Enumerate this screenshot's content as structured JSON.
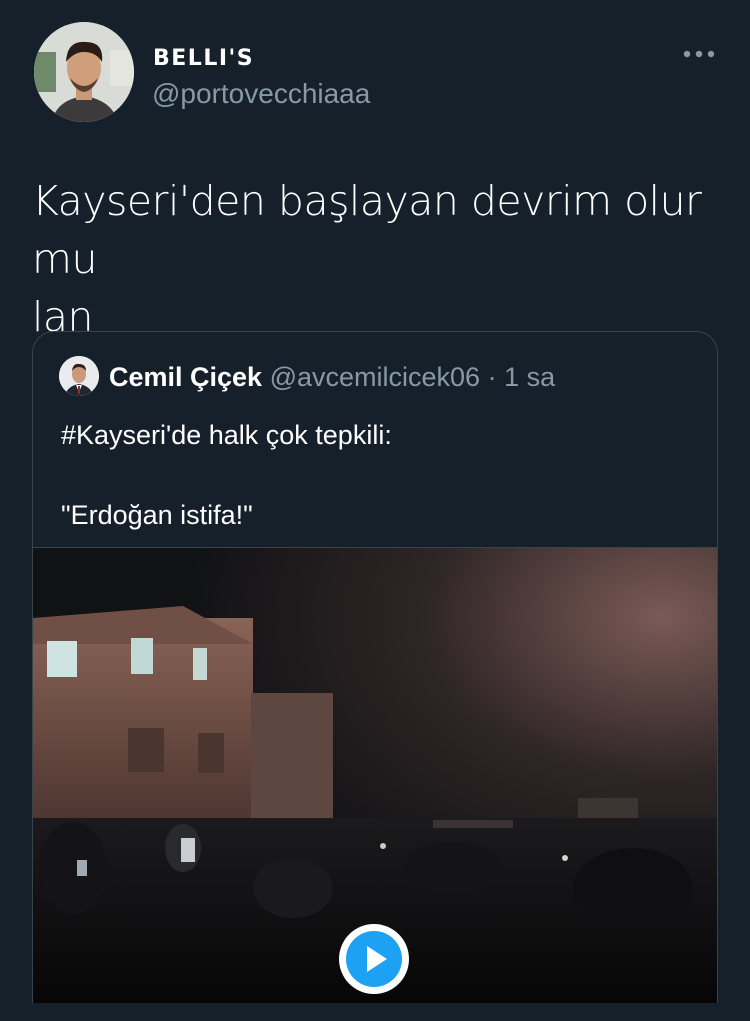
{
  "tweet": {
    "display_name": "BELLI'S",
    "handle": "@portovecchiaaa",
    "text_line1": "Kayseri'den başlayan devrim olur mu",
    "text_line2": "lan",
    "more_icon": "more-dots-icon"
  },
  "quote": {
    "name": "Cemil Çiçek",
    "handle": "@avcemilcicek06",
    "separator": "·",
    "time": "1 sa",
    "text_line1": "#Kayseri'de halk çok tepkili:",
    "text_line2": "\"Erdoğan istifa!\""
  },
  "media": {
    "type": "video",
    "play_icon": "play-icon"
  },
  "colors": {
    "background": "#15202b",
    "secondary_text": "#8899a6",
    "border": "#38444d",
    "accent": "#1da1f2"
  }
}
